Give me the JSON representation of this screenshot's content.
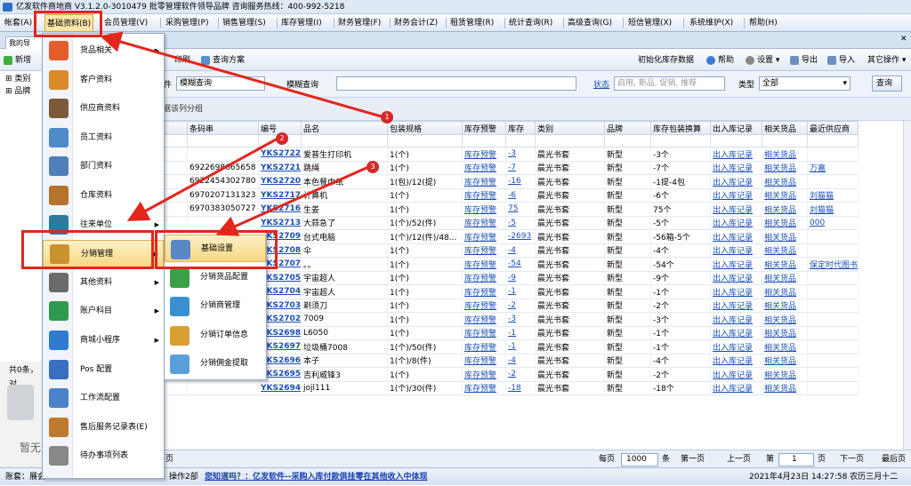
{
  "window": {
    "title": "亿发软件商地商 V3.1.2.0-3010479 批零管理软件领导品牌 咨询服务热线：400-992-5218"
  },
  "menubar": [
    "帐套(A)",
    "基础资料(B)",
    "会员管理(V)",
    "采购管理(P)",
    "销售管理(S)",
    "库存管理(I)",
    "财务管理(F)",
    "财务会计(Z)",
    "租赁管理(R)",
    "统计查询(R)",
    "高级查询(G)",
    "短信管理(X)",
    "系统维护(X)",
    "帮助(H)"
  ],
  "doc_tab": "我的导",
  "toolbar": {
    "new": "新增",
    "print": "印刷",
    "scheme": "查询方案",
    "init": "初始化库存数据",
    "help": "帮助",
    "settings": "设置",
    "export": "导出",
    "import": "导入",
    "other": "其它操作"
  },
  "left_tree": [
    "类别",
    "品牌"
  ],
  "left_bottom": {
    "share": "共0条，对",
    "empty": "暂无"
  },
  "search": {
    "field_label": "件",
    "field_value": "模糊查询",
    "fuzzy_label": "模糊查询",
    "status_label": "状态",
    "status_placeholder": "启用, 新品, 促销, 推荐",
    "type_label": "类型",
    "type_value": "全部",
    "query": "查询"
  },
  "group_hint": "根据该列分组",
  "columns": [
    "间",
    "条码串",
    "编号",
    "品名",
    "包装规格",
    "库存预警",
    "库存",
    "类别",
    "品牌",
    "库存包装换算",
    "出入库记录",
    "相关货品",
    "最近供应商"
  ],
  "rows": [
    [
      "3月13日 22:34:50",
      "",
      "YKS2722",
      "爱普生打印机",
      "1(个)",
      "库存预警",
      "-3",
      "晨光书套",
      "新型",
      "-3个",
      "出入库记录",
      "相关货品",
      ""
    ],
    [
      "3月13日 11:10:12",
      "6922698665658",
      "YKS2721",
      "跳绳",
      "1(个)",
      "库存预警",
      "-7",
      "晨光书套",
      "新型",
      "-7个",
      "出入库记录",
      "相关货品",
      "万嘉"
    ],
    [
      "3月11日 21:46:45",
      "6922454302780",
      "YKS2720",
      "本色餐巾纸",
      "1(包)/12(提)",
      "库存预警",
      "-16",
      "晨光书套",
      "新型",
      "-1提-4包",
      "出入库记录",
      "相关货品",
      ""
    ],
    [
      "3月11日 12:40:22",
      "6970207131323",
      "YKS2717",
      "计算机",
      "1(个)",
      "库存预警",
      "-6",
      "晨光书套",
      "新型",
      "-6个",
      "出入库记录",
      "相关货品",
      "刘猫猫"
    ],
    [
      "3月10日 14:27:33",
      "6970383050727",
      "YKS2716",
      "生姜",
      "1(个)",
      "库存预警",
      "75",
      "晨光书套",
      "新型",
      "75个",
      "出入库记录",
      "相关货品",
      "刘猫猫"
    ],
    [
      "",
      "",
      "YKS2713",
      "大蒜急了",
      "1(个)/52(件)",
      "库存预警",
      "-5",
      "晨光书套",
      "新型",
      "-5个",
      "出入库记录",
      "相关货品",
      "000"
    ],
    [
      "",
      "",
      "YKS2709",
      "台式电脑",
      "1(个)/12(件)/48...",
      "库存预警",
      "-2693",
      "晨光书套",
      "新型",
      "-56箱-5个",
      "出入库记录",
      "相关货品",
      ""
    ],
    [
      "",
      "2027...",
      "YKS2708",
      "伞",
      "1(个)",
      "库存预警",
      "-4",
      "晨光书套",
      "新型",
      "-4个",
      "出入库记录",
      "相关货品",
      ""
    ],
    [
      "",
      "4,695...",
      "YKS2707",
      "。。",
      "1(个)",
      "库存预警",
      "-54",
      "晨光书套",
      "新型",
      "-54个",
      "出入库记录",
      "相关货品",
      "保定时代图书"
    ],
    [
      "",
      "54,692...",
      "YKS2705",
      "宇宙超人",
      "1(个)",
      "库存预警",
      "-9",
      "晨光书套",
      "新型",
      "-9个",
      "出入库记录",
      "相关货品",
      ""
    ],
    [
      "",
      "",
      "YKS2704",
      "宇宙超人",
      "1(个)",
      "库存预警",
      "-1",
      "晨光书套",
      "新型",
      "-1个",
      "出入库记录",
      "相关货品",
      ""
    ],
    [
      "",
      "3900035",
      "YKS2703",
      "剃须刀",
      "1(个)",
      "库存预警",
      "-2",
      "晨光书套",
      "新型",
      "-2个",
      "出入库记录",
      "相关货品",
      ""
    ],
    [
      "",
      "5070095",
      "YKS2702",
      "7009",
      "1(个)",
      "库存预警",
      "-3",
      "晨光书套",
      "新型",
      "-3个",
      "出入库记录",
      "相关货品",
      ""
    ],
    [
      "",
      "8160501",
      "YKS2698",
      "L6050",
      "1(个)",
      "库存预警",
      "-1",
      "晨光书套",
      "新型",
      "-1个",
      "出入库记录",
      "相关货品",
      ""
    ],
    [
      "",
      "5070088",
      "YKS2697",
      "垃圾桶7008",
      "1(个)/50(件)",
      "库存预警",
      "-1",
      "晨光书套",
      "新型",
      "-1个",
      "出入库记录",
      "相关货品",
      ""
    ],
    [
      "",
      "",
      "YKS2696",
      "本子",
      "1(个)/8(件)",
      "库存预警",
      "-4",
      "晨光书套",
      "新型",
      "-4个",
      "出入库记录",
      "相关货品",
      ""
    ],
    [
      "3月4日 10:07:38",
      "6900068804463",
      "YKS2695",
      "吉利威锋3",
      "1(个)",
      "库存预警",
      "-2",
      "晨光书套",
      "新型",
      "-2个",
      "出入库记录",
      "相关货品",
      ""
    ],
    [
      "3月3日 17:06:51",
      "",
      "YKS2694",
      "jojl111",
      "1(个)/30(件)",
      "库存预警",
      "-18",
      "晨光书套",
      "新型",
      "-18个",
      "出入库记录",
      "相关货品",
      ""
    ]
  ],
  "pager": {
    "page_tail": "页",
    "per_page": "每页",
    "per_value": "1000",
    "per_unit": "条",
    "first": "第一页",
    "prev": "上一页",
    "page_prefix": "第",
    "page_value": "1",
    "page_suffix": "页",
    "next": "下一页",
    "last": "最后页"
  },
  "status": {
    "account": "账套：展会",
    "user": "操作2部",
    "marquee": "您知道吗？：亿发软件--采购入库付款俱挂零在其他收入中体现",
    "datetime": "2021年4月23日 14:27:58 农历三月十二"
  },
  "dropdown_menu": [
    "货品相关",
    "客户资料",
    "供应商资料",
    "员工资料",
    "部门资料",
    "仓库资料",
    "往来单位",
    "分销管理",
    "其他资料",
    "账户科目",
    "商城小程序",
    "Pos 配置",
    "工作流配置",
    "售后服务记录表(E)",
    "待办事项列表"
  ],
  "submenu": [
    "基础设置",
    "分销货品配置",
    "分销商管理",
    "分销订单信息",
    "分销佣金提取"
  ],
  "badges": [
    "1",
    "2",
    "3"
  ]
}
